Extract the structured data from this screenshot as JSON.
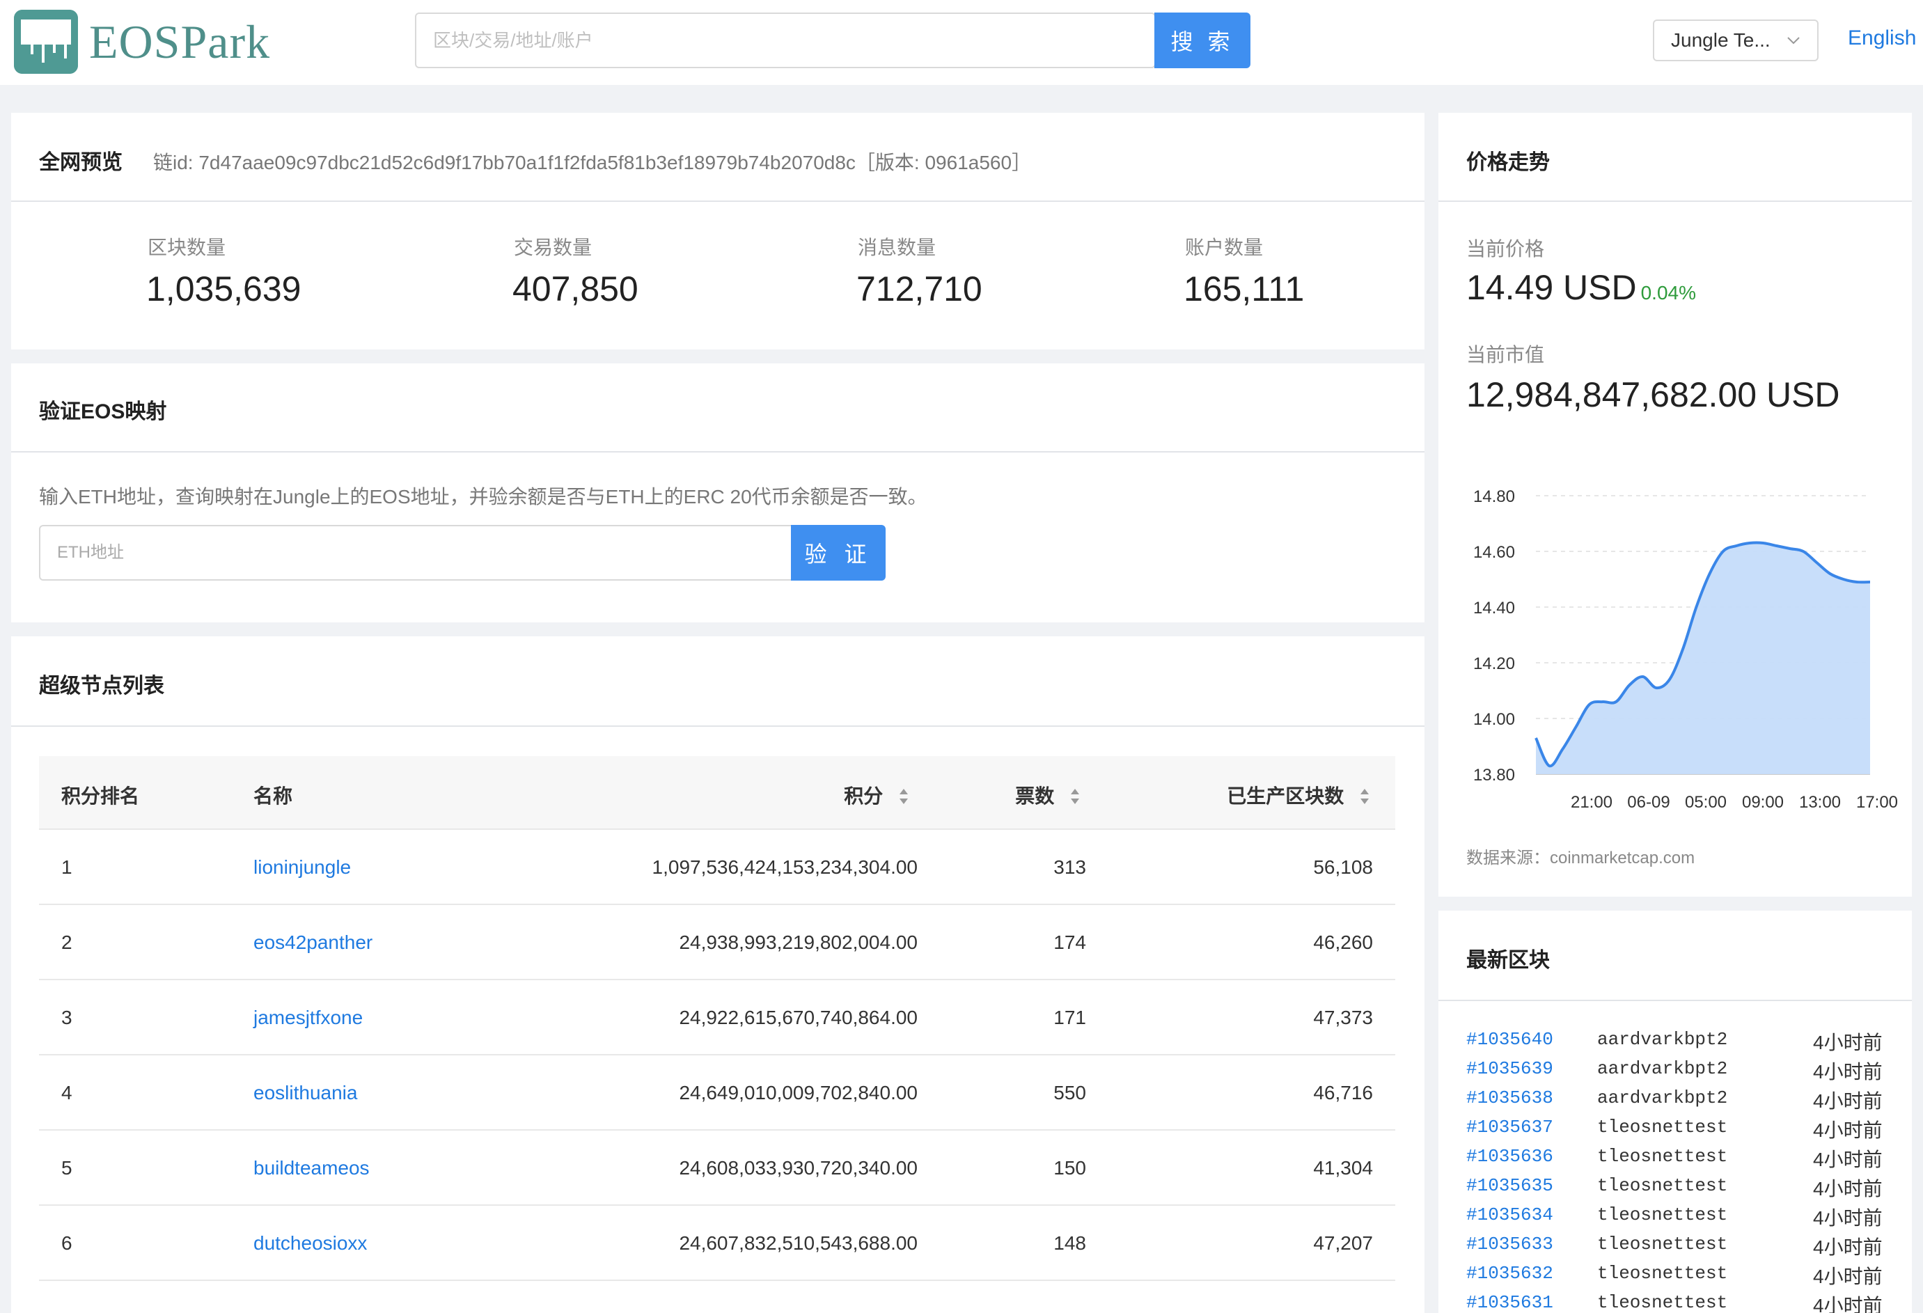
{
  "header": {
    "logo_text": "EOSPark",
    "search_placeholder": "区块/交易/地址/账户",
    "search_button": "搜 索",
    "network": "Jungle Te...",
    "language": "English"
  },
  "overview": {
    "title": "全网预览",
    "chain_id": "链id: 7d47aae09c97dbc21d52c6d9f17bb70a1f1f2fda5f81b3ef18979b74b2070d8c［版本: 0961a560］",
    "stats": [
      {
        "label": "区块数量",
        "value": "1,035,639"
      },
      {
        "label": "交易数量",
        "value": "407,850"
      },
      {
        "label": "消息数量",
        "value": "712,710"
      },
      {
        "label": "账户数量",
        "value": "165,111"
      }
    ]
  },
  "verify": {
    "title": "验证EOS映射",
    "description": "输入ETH地址，查询映射在Jungle上的EOS地址，并验余额是否与ETH上的ERC 20代币余额是否一致。",
    "input_placeholder": "ETH地址",
    "button": "验 证"
  },
  "producers": {
    "title": "超级节点列表",
    "columns": [
      "积分排名",
      "名称",
      "积分",
      "票数",
      "已生产区块数"
    ],
    "rows": [
      {
        "rank": "1",
        "name": "lioninjungle",
        "score": "1,097,536,424,153,234,304.00",
        "votes": "313",
        "blocks": "56,108"
      },
      {
        "rank": "2",
        "name": "eos42panther",
        "score": "24,938,993,219,802,004.00",
        "votes": "174",
        "blocks": "46,260"
      },
      {
        "rank": "3",
        "name": "jamesjtfxone",
        "score": "24,922,615,670,740,864.00",
        "votes": "171",
        "blocks": "47,373"
      },
      {
        "rank": "4",
        "name": "eoslithuania",
        "score": "24,649,010,009,702,840.00",
        "votes": "550",
        "blocks": "46,716"
      },
      {
        "rank": "5",
        "name": "buildteameos",
        "score": "24,608,033,930,720,340.00",
        "votes": "150",
        "blocks": "41,304"
      },
      {
        "rank": "6",
        "name": "dutcheosioxx",
        "score": "24,607,832,510,543,688.00",
        "votes": "148",
        "blocks": "47,207"
      }
    ]
  },
  "price": {
    "title": "价格走势",
    "current_price_label": "当前价格",
    "current_price": "14.49 USD",
    "change": "0.04%",
    "market_cap_label": "当前市值",
    "market_cap": "12,984,847,682.00 USD",
    "source": "数据来源：coinmarketcap.com",
    "colors": {
      "line": "#3a86e8",
      "fill": "#c5dcfa",
      "up": "#2e9b3b"
    }
  },
  "chart_data": {
    "type": "area",
    "ylim": [
      13.8,
      14.8
    ],
    "yticks": [
      "14.80",
      "14.60",
      "14.40",
      "14.20",
      "14.00",
      "13.80"
    ],
    "xticks": [
      "21:00",
      "06-09",
      "05:00",
      "09:00",
      "13:00",
      "17:00"
    ],
    "x": [
      0,
      1,
      2,
      3,
      4,
      5,
      6,
      7,
      8,
      9,
      10,
      11,
      12,
      13,
      14,
      15,
      16,
      17,
      18,
      19,
      20,
      21,
      22,
      23,
      24,
      25
    ],
    "values": [
      13.93,
      13.83,
      13.89,
      13.97,
      14.05,
      14.06,
      14.06,
      14.12,
      14.15,
      14.11,
      14.14,
      14.25,
      14.4,
      14.52,
      14.6,
      14.62,
      14.63,
      14.63,
      14.62,
      14.61,
      14.6,
      14.56,
      14.52,
      14.5,
      14.49,
      14.49
    ],
    "grid": true
  },
  "latest_blocks": {
    "title": "最新区块",
    "items": [
      {
        "id": "#1035640",
        "producer": "aardvarkbpt2",
        "time": "4小时前"
      },
      {
        "id": "#1035639",
        "producer": "aardvarkbpt2",
        "time": "4小时前"
      },
      {
        "id": "#1035638",
        "producer": "aardvarkbpt2",
        "time": "4小时前"
      },
      {
        "id": "#1035637",
        "producer": "tleosnettest",
        "time": "4小时前"
      },
      {
        "id": "#1035636",
        "producer": "tleosnettest",
        "time": "4小时前"
      },
      {
        "id": "#1035635",
        "producer": "tleosnettest",
        "time": "4小时前"
      },
      {
        "id": "#1035634",
        "producer": "tleosnettest",
        "time": "4小时前"
      },
      {
        "id": "#1035633",
        "producer": "tleosnettest",
        "time": "4小时前"
      },
      {
        "id": "#1035632",
        "producer": "tleosnettest",
        "time": "4小时前"
      },
      {
        "id": "#1035631",
        "producer": "tleosnettest",
        "time": "4小时前"
      }
    ]
  }
}
